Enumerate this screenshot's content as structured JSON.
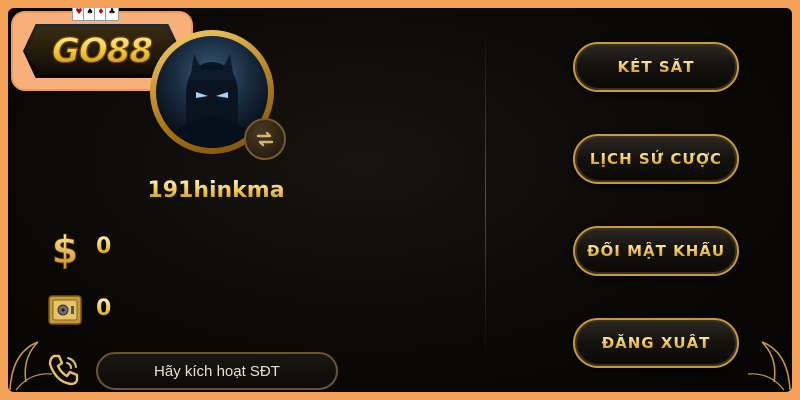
{
  "logo": {
    "text": "GO88"
  },
  "profile": {
    "username": "191hinkma",
    "balance": "0",
    "safe_balance": "0"
  },
  "phone": {
    "activate_label": "Hãy kích hoạt SĐT"
  },
  "menu": {
    "items": [
      {
        "label": "KÉT SẮT"
      },
      {
        "label": "LỊCH SỬ CƯỢC"
      },
      {
        "label": "ĐỔI MẬT KHẨU"
      },
      {
        "label": "ĐĂNG XUẤT"
      }
    ]
  },
  "colors": {
    "frame": "#f4a25a",
    "gold": "#f0c24a",
    "panel": "#0b0907"
  },
  "icons": [
    "dollar-icon",
    "safe-icon",
    "phone-icon",
    "swap-icon"
  ]
}
